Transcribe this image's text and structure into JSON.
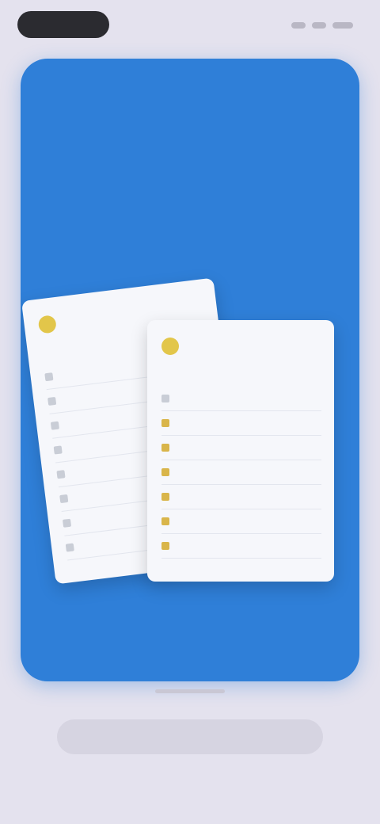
{
  "colors": {
    "background": "#e4e2ee",
    "card": "#2f7fd8",
    "document": "#f6f7fb",
    "accent_logo": "#e2c64a"
  },
  "card": {
    "headline": ""
  },
  "documents": {
    "back": {
      "title": "",
      "subtitle": "",
      "lines": [
        "",
        "",
        "",
        "",
        "",
        "",
        "",
        ""
      ]
    },
    "front": {
      "title": "",
      "subtitle": "",
      "lines": [
        "",
        "",
        "",
        "",
        "",
        "",
        ""
      ]
    }
  },
  "cta": {
    "label": ""
  }
}
